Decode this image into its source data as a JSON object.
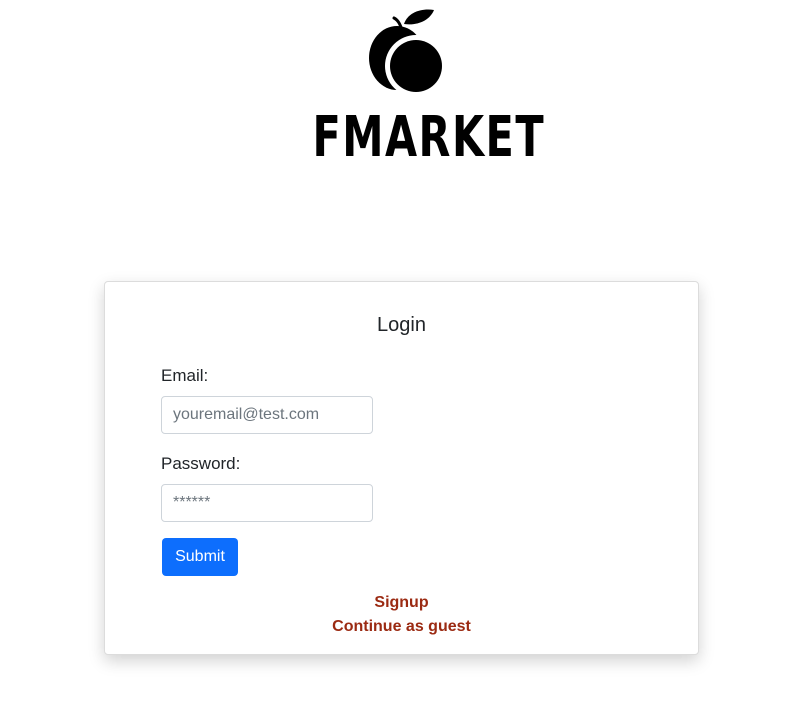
{
  "brand": {
    "name": "FMARKET",
    "logo_icon": "peach-icon",
    "logo_color": "#000000"
  },
  "login": {
    "title": "Login",
    "email_label": "Email:",
    "email_placeholder": "youremail@test.com",
    "email_value": "",
    "password_label": "Password:",
    "password_placeholder": "******",
    "password_value": "",
    "submit_label": "Submit",
    "signup_link": "Signup",
    "guest_link": "Continue as guest"
  },
  "colors": {
    "primary_button": "#0d6efd",
    "link": "#9b2a12",
    "background": "#ffffff"
  }
}
